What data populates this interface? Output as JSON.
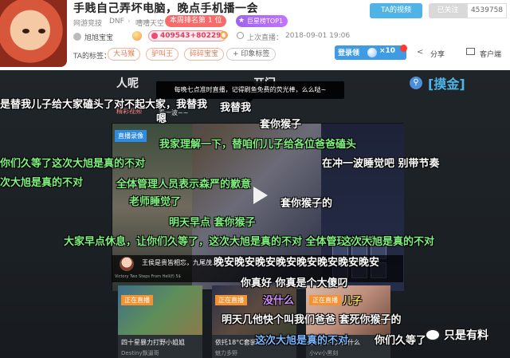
{
  "header": {
    "title": "手贱自己弄坏电脑，晚点手机播一会",
    "category_1": "网游竞技",
    "category_2": "DNF",
    "category_3": "嘈嘈天空",
    "rank_badge": "本周排名第  1  位",
    "star_badge": "巨星榜TOP1",
    "username": "旭旭宝宝",
    "heat": "409543+80229",
    "last_live_label": "上次直播：",
    "last_live_time": "2018-09-01 19:06",
    "tags_label": "TA的标签：",
    "tags": [
      "大马猴",
      "驴叫王",
      "碎碎宝宝"
    ],
    "tag_add": "+ 印象标签",
    "video_button": "TA的视频",
    "follow_button": "已关注",
    "follow_count": "4539758",
    "login_label": "登录领",
    "yuwan_count": "×10",
    "notify_count": "1",
    "share_label": "分享",
    "client_label": "客户端"
  },
  "player": {
    "tooltip": "每晚七点准时直播，记得刷鱼免费的荧光棒，么么哒~",
    "channel_left": "人呢",
    "channel_mid": "开门",
    "link_glyph": "⚲",
    "lb": "[摸金]",
    "rec_label": "精彩视频",
    "rec_label_2": "看一波~~",
    "recording_badge": "直播录像",
    "rec_title": "王侯是贵皆相忘，九尾茂...",
    "rec_sub": "Victory Two Steps From Hell(f) 5$"
  },
  "cards": [
    {
      "badge": "正在直播",
      "title": "四十星暴力打野小姐姐",
      "author": "Destiny飘逼哥"
    },
    {
      "badge": "正在直播",
      "title": "依托18°C套装打劳",
      "author": "魅力多野"
    },
    {
      "badge": "正在直播",
      "title": "拿我你今天做什么",
      "author": "小vv小黑刻"
    }
  ],
  "danmaku": [
    "是替我儿子给大家磕头了对不起大家，我替我",
    "嗯",
    "套你猴子",
    "我家理解一下，替咱们儿子给各位爸爸磕头",
    "你们久等了这次大旭是真的不对",
    "在冲一波睡觉吧 别带节奏",
    "次大旭是真的不对",
    "全体管理人员表示森严的歉意",
    "老师睡觉了",
    "套你猴子的",
    "明天早点 套你猴子",
    "大家早点休息，让你们久等了，这次大旭是真的不对 全体管理人员表示",
    "晚安晚安晚安晚安晚安晚安晚安晚安",
    "你真好 你真是个大傻叼",
    "明天几他快个叫我们爸爸 套死你猴子的",
    "这次大旭是真的不对",
    "你们久等了",
    "没什么",
    "儿子",
    "我替我",
    "这次大旭是真的不对"
  ],
  "watermark": "只是有料"
}
